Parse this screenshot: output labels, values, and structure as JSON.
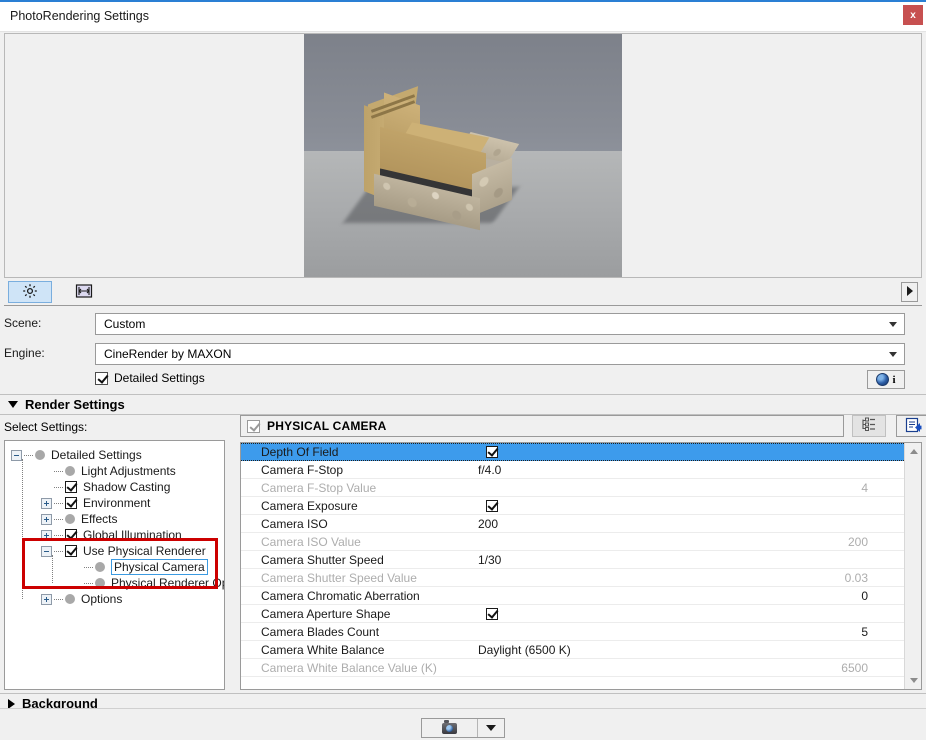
{
  "window": {
    "title": "PhotoRendering Settings",
    "close_label": "x",
    "accent_color": "#2a7fd4",
    "close_color": "#c75050",
    "selection_color": "#3d9bec",
    "annotation_color": "#cc0000"
  },
  "preview": {
    "alt": "3d-render-preview"
  },
  "tabstrip": {
    "tabs": [
      {
        "name": "settings-tab",
        "icon": "gear-icon",
        "selected": true
      },
      {
        "name": "size-tab",
        "icon": "image-size-icon",
        "selected": false
      }
    ],
    "overflow_icon": "arrow-right-icon"
  },
  "fields": {
    "scene": {
      "label": "Scene:",
      "value": "Custom"
    },
    "engine": {
      "label": "Engine:",
      "value": "CineRender by MAXON"
    },
    "detailed_settings": {
      "label": "Detailed Settings",
      "checked": true
    },
    "info_button": {
      "icon": "globe-icon",
      "label": "i"
    }
  },
  "render_settings": {
    "title": "Render Settings",
    "expanded": true,
    "select_settings_label": "Select Settings:"
  },
  "background_section": {
    "title": "Background",
    "expanded": false
  },
  "tree": {
    "nodes": [
      {
        "label": "Detailed Settings",
        "depth": 0,
        "expander": "minus",
        "icon": "dot-icon",
        "selected": false
      },
      {
        "label": "Light Adjustments",
        "depth": 1,
        "expander": "none",
        "icon": "dot-icon",
        "selected": false
      },
      {
        "label": "Shadow Casting",
        "depth": 1,
        "expander": "none",
        "icon": "checkbox-checked",
        "selected": false
      },
      {
        "label": "Environment",
        "depth": 1,
        "expander": "plus",
        "icon": "checkbox-checked",
        "selected": false
      },
      {
        "label": "Effects",
        "depth": 1,
        "expander": "plus",
        "icon": "dot-icon",
        "selected": false
      },
      {
        "label": "Global Illumination",
        "depth": 1,
        "expander": "plus",
        "icon": "checkbox-checked",
        "selected": false
      },
      {
        "label": "Use Physical Renderer",
        "depth": 1,
        "expander": "minus",
        "icon": "checkbox-checked",
        "selected": false
      },
      {
        "label": "Physical Camera",
        "depth": 2,
        "expander": "none",
        "icon": "dot-icon",
        "selected": true
      },
      {
        "label": "Physical Renderer Options",
        "depth": 2,
        "expander": "none",
        "icon": "dot-icon",
        "selected": false
      },
      {
        "label": "Options",
        "depth": 1,
        "expander": "plus",
        "icon": "dot-icon",
        "selected": false
      }
    ]
  },
  "properties": {
    "header": {
      "title": "PHYSICAL CAMERA",
      "checkbox_checked": true,
      "list_view_icon": "tree-list-icon",
      "export_icon": "export-settings-icon"
    },
    "rows": [
      {
        "name": "Depth Of Field",
        "value": "",
        "type": "checkbox",
        "checked": true,
        "selected": true,
        "dim": false
      },
      {
        "name": "Camera F-Stop",
        "value": "f/4.0",
        "type": "text-left",
        "selected": false,
        "dim": false
      },
      {
        "name": "Camera F-Stop Value",
        "value": "4",
        "type": "text-right",
        "selected": false,
        "dim": true
      },
      {
        "name": "Camera Exposure",
        "value": "",
        "type": "checkbox",
        "checked": true,
        "selected": false,
        "dim": false
      },
      {
        "name": "Camera ISO",
        "value": "200",
        "type": "text-left",
        "selected": false,
        "dim": false
      },
      {
        "name": "Camera ISO Value",
        "value": "200",
        "type": "text-right",
        "selected": false,
        "dim": true
      },
      {
        "name": "Camera Shutter Speed",
        "value": "1/30",
        "type": "text-left",
        "selected": false,
        "dim": false
      },
      {
        "name": "Camera Shutter Speed Value",
        "value": "0.03",
        "type": "text-right",
        "selected": false,
        "dim": true
      },
      {
        "name": "Camera Chromatic Aberration",
        "value": "0",
        "type": "text-right",
        "selected": false,
        "dim": false
      },
      {
        "name": "Camera Aperture Shape",
        "value": "",
        "type": "checkbox",
        "checked": true,
        "selected": false,
        "dim": false
      },
      {
        "name": "Camera Blades Count",
        "value": "5",
        "type": "text-right",
        "selected": false,
        "dim": false
      },
      {
        "name": "Camera White Balance",
        "value": "Daylight (6500 K)",
        "type": "text-left",
        "selected": false,
        "dim": false
      },
      {
        "name": "Camera White Balance Value (K)",
        "value": "6500",
        "type": "text-right",
        "selected": false,
        "dim": true
      }
    ],
    "scrollbar": {
      "up_icon": "scroll-up-icon",
      "down_icon": "scroll-down-icon"
    }
  },
  "footer": {
    "render_button": {
      "icon": "camera-icon",
      "dropdown_icon": "chevron-down-icon"
    }
  }
}
